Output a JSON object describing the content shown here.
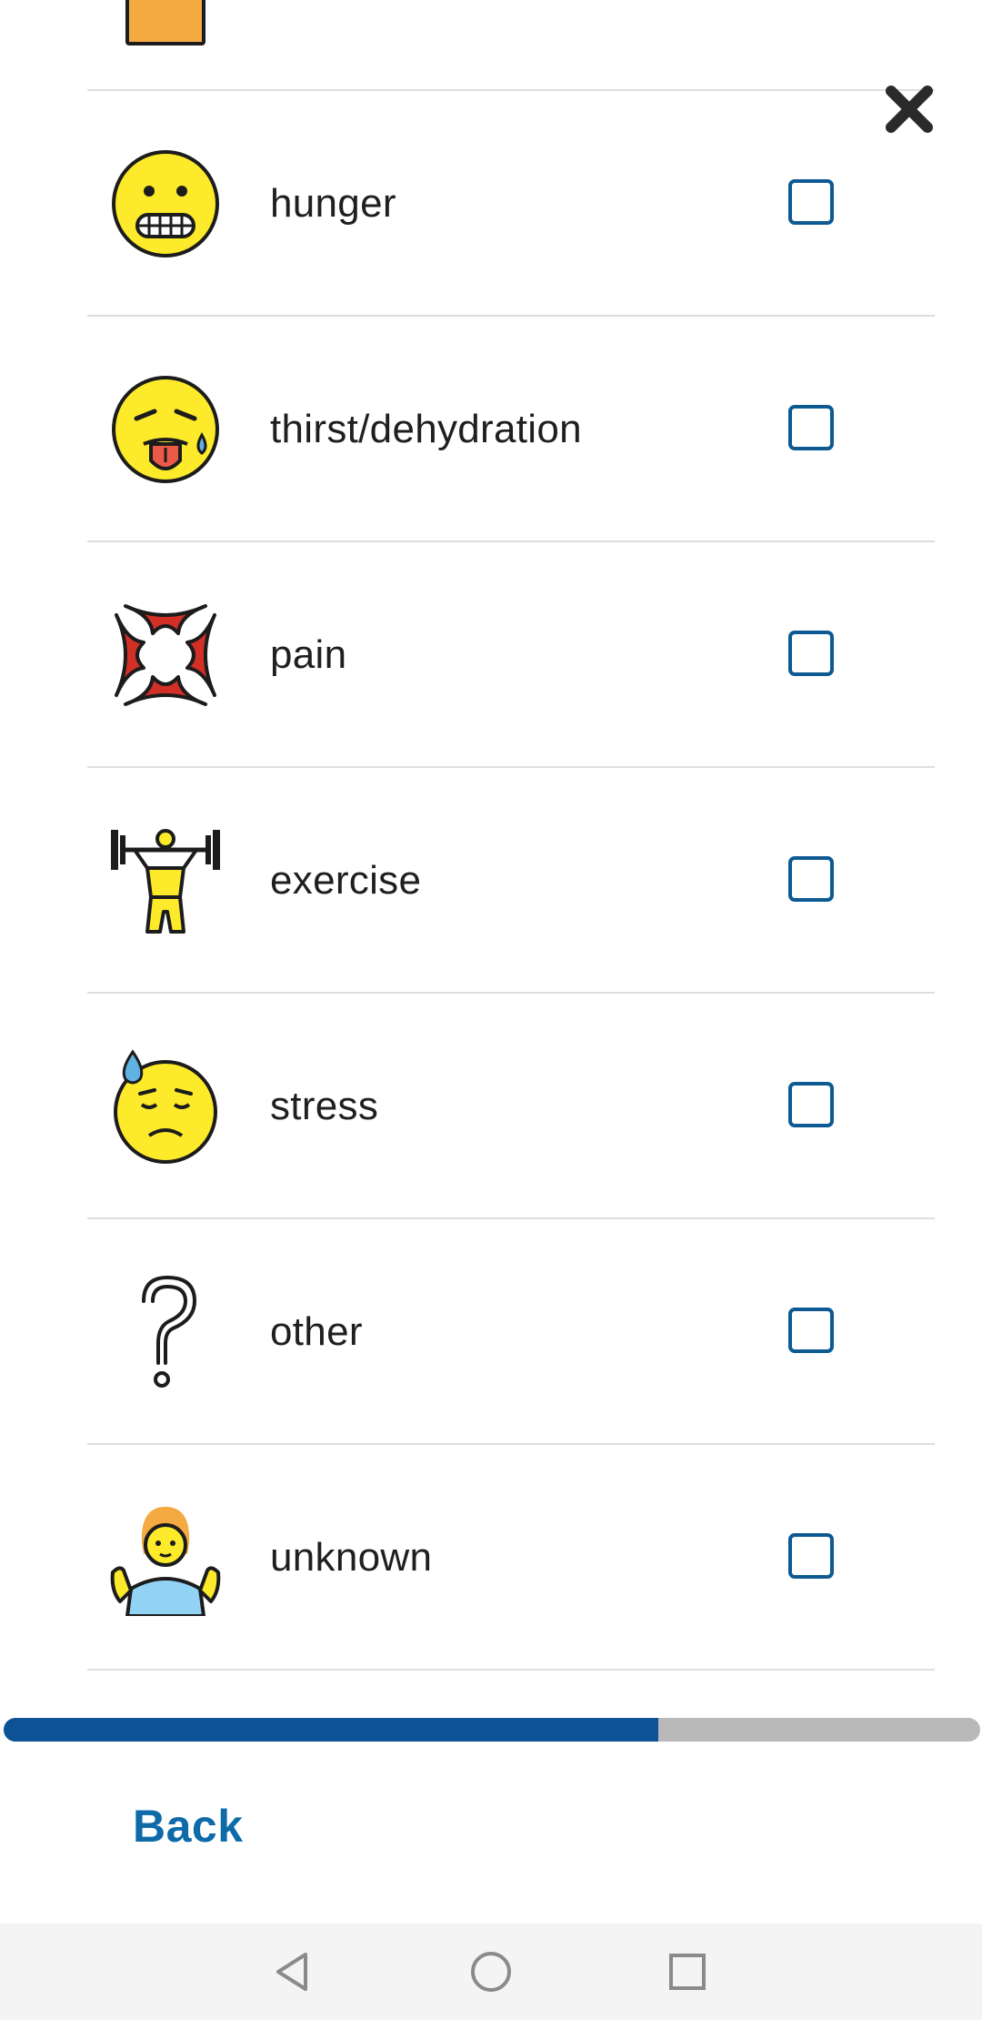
{
  "items": [
    {
      "id": "hunger",
      "label": "hunger",
      "checked": false,
      "icon": "grimacing-face-icon"
    },
    {
      "id": "thirst",
      "label": "thirst/dehydration",
      "checked": false,
      "icon": "hot-face-icon"
    },
    {
      "id": "pain",
      "label": "pain",
      "checked": false,
      "icon": "anger-symbol-icon"
    },
    {
      "id": "exercise",
      "label": "exercise",
      "checked": false,
      "icon": "weight-lifting-icon"
    },
    {
      "id": "stress",
      "label": "stress",
      "checked": false,
      "icon": "downcast-sweat-face-icon"
    },
    {
      "id": "other",
      "label": "other",
      "checked": false,
      "icon": "question-mark-icon"
    },
    {
      "id": "unknown",
      "label": "unknown",
      "checked": false,
      "icon": "person-shrugging-icon"
    }
  ],
  "progress": {
    "fraction": 0.67
  },
  "footer": {
    "back_label": "Back"
  },
  "colors": {
    "accent": "#0b5394",
    "checkbox": "#0d5a92",
    "link": "#0e6aa8",
    "track": "#b9b9b9"
  }
}
